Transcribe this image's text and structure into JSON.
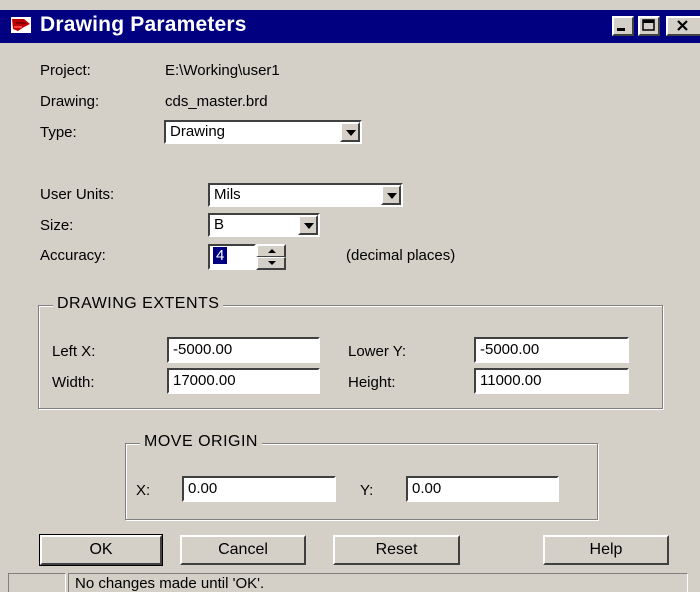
{
  "window": {
    "title": "Drawing Parameters",
    "icon": "app-brush-icon",
    "controls": [
      "minimize-icon",
      "maximize-icon",
      "close-icon"
    ]
  },
  "info": {
    "project_label": "Project:",
    "project_value": "E:\\Working\\user1",
    "drawing_label": "Drawing:",
    "drawing_value": "cds_master.brd",
    "type_label": "Type:",
    "type_value": "Drawing"
  },
  "units": {
    "user_units_label": "User Units:",
    "user_units_value": "Mils",
    "size_label": "Size:",
    "size_value": "B",
    "accuracy_label": "Accuracy:",
    "accuracy_value": "4",
    "accuracy_suffix": "(decimal places)"
  },
  "extents": {
    "title": "DRAWING EXTENTS",
    "left_x_label": "Left X:",
    "left_x_value": "-5000.00",
    "lower_y_label": "Lower Y:",
    "lower_y_value": "-5000.00",
    "width_label": "Width:",
    "width_value": "17000.00",
    "height_label": "Height:",
    "height_value": "11000.00"
  },
  "origin": {
    "title": "MOVE ORIGIN",
    "x_label": "X:",
    "x_value": "0.00",
    "y_label": "Y:",
    "y_value": "0.00"
  },
  "buttons": {
    "ok": "OK",
    "cancel": "Cancel",
    "reset": "Reset",
    "help": "Help"
  },
  "status": {
    "message": "No changes made until 'OK'."
  },
  "colors": {
    "titlebar": "#000080",
    "face": "#d4d0c8"
  }
}
